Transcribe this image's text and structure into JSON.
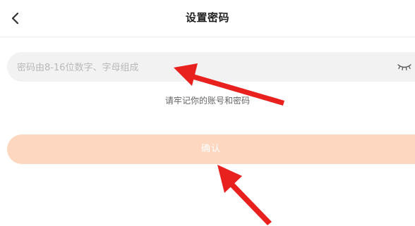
{
  "header": {
    "title": "设置密码",
    "back_icon": "chevron-left-icon"
  },
  "password": {
    "placeholder": "密码由8-16位数字、字母组成",
    "value": "",
    "visibility_icon": "eye-closed-icon"
  },
  "hint": "请牢记你的账号和密码",
  "confirm": {
    "label": "确认",
    "color": "#fdd7bf"
  },
  "annotation": {
    "arrow_color": "#e8211e"
  }
}
